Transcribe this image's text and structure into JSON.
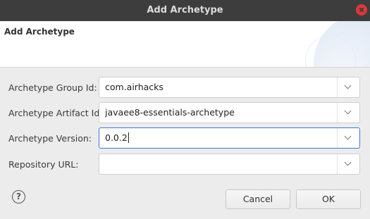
{
  "window": {
    "title": "Add Archetype"
  },
  "header": {
    "title": "Add Archetype"
  },
  "fields": [
    {
      "label": "Archetype Group Id:",
      "value": "com.airhacks"
    },
    {
      "label": "Archetype Artifact Id:",
      "value": "javaee8-essentials-archetype"
    },
    {
      "label": "Archetype Version:",
      "value": "0.0.2"
    },
    {
      "label": "Repository URL:",
      "value": ""
    }
  ],
  "buttons": {
    "cancel": "Cancel",
    "ok": "OK",
    "help": "?"
  },
  "colors": {
    "titlebar": "#3d3d3d",
    "close": "#e0373b",
    "focus": "#3b7bd8"
  }
}
